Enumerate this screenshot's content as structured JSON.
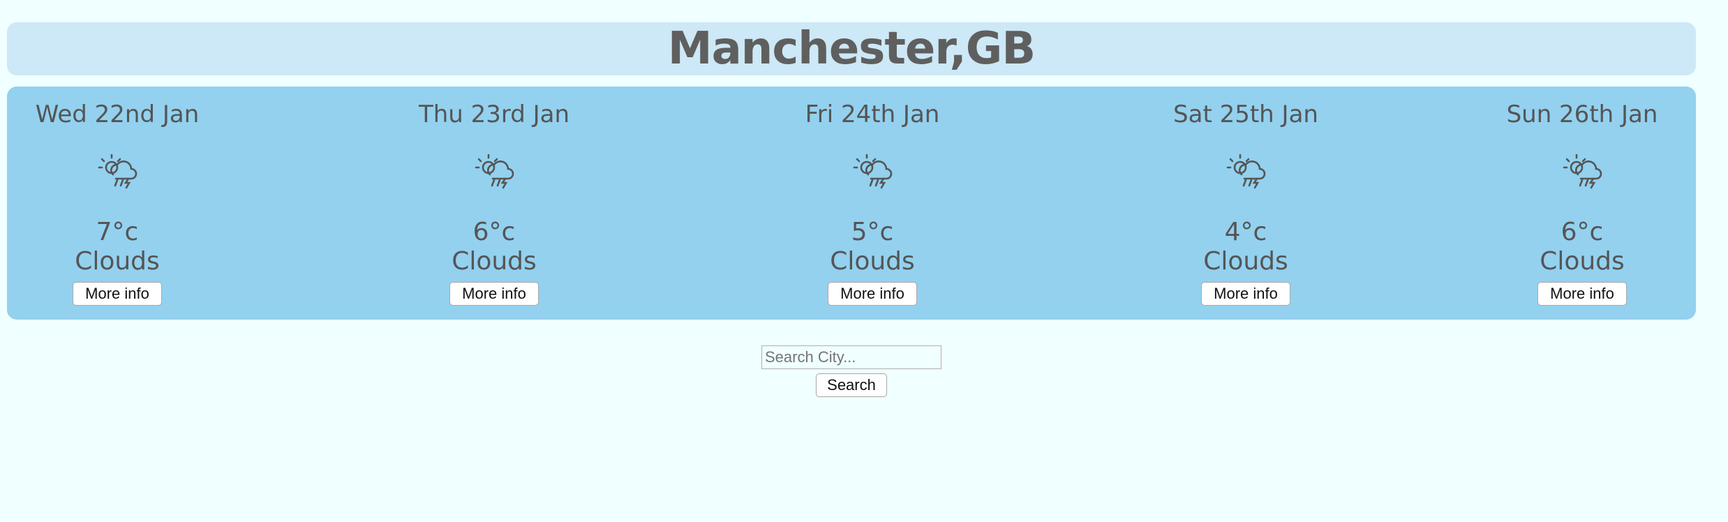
{
  "header": {
    "city": "Manchester,GB"
  },
  "forecast": [
    {
      "day": "Wed 22nd Jan",
      "temp": "7°c",
      "description": "Clouds",
      "icon": "sun-cloud-rain-icon",
      "button_label": "More info"
    },
    {
      "day": "Thu 23rd Jan",
      "temp": "6°c",
      "description": "Clouds",
      "icon": "sun-cloud-rain-icon",
      "button_label": "More info"
    },
    {
      "day": "Fri 24th Jan",
      "temp": "5°c",
      "description": "Clouds",
      "icon": "sun-cloud-rain-icon",
      "button_label": "More info"
    },
    {
      "day": "Sat 25th Jan",
      "temp": "4°c",
      "description": "Clouds",
      "icon": "sun-cloud-rain-icon",
      "button_label": "More info"
    },
    {
      "day": "Sun 26th Jan",
      "temp": "6°c",
      "description": "Clouds",
      "icon": "sun-cloud-rain-icon",
      "button_label": "More info"
    }
  ],
  "search": {
    "placeholder": "Search City...",
    "value": "",
    "button_label": "Search"
  },
  "colors": {
    "background": "#f0ffff",
    "header_bg": "#cde8f6",
    "forecast_bg": "#93d1ef",
    "text": "#5a5a5a"
  }
}
